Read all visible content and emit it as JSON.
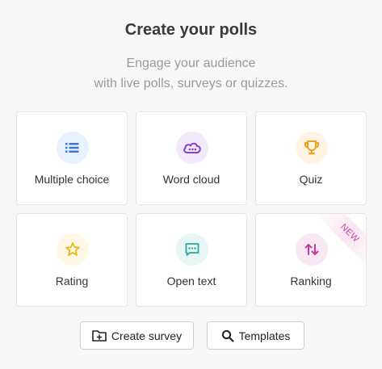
{
  "header": {
    "title": "Create your polls",
    "subtitle_line1": "Engage your audience",
    "subtitle_line2": "with live polls, surveys or quizzes."
  },
  "cards": [
    {
      "label": "Multiple choice",
      "icon": "list-icon",
      "color": "#3a78d6",
      "bg": "#e8f1fd"
    },
    {
      "label": "Word cloud",
      "icon": "cloud-icon",
      "color": "#8a3fd1",
      "bg": "#f2eafb"
    },
    {
      "label": "Quiz",
      "icon": "trophy-icon",
      "color": "#f0a020",
      "bg": "#fff4e4"
    },
    {
      "label": "Rating",
      "icon": "star-icon",
      "color": "#e8b820",
      "bg": "#fff8e4"
    },
    {
      "label": "Open text",
      "icon": "chat-icon",
      "color": "#2aa79c",
      "bg": "#e6f6f4"
    },
    {
      "label": "Ranking",
      "icon": "sort-arrows-icon",
      "color": "#c23a9a",
      "bg": "#f9e8f3",
      "badge": "NEW"
    }
  ],
  "actions": {
    "create_survey": "Create survey",
    "templates": "Templates"
  }
}
